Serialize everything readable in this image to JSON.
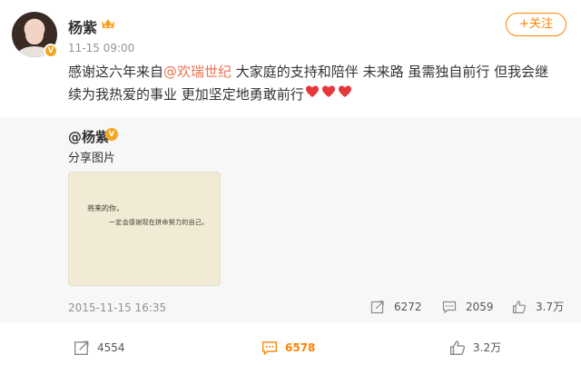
{
  "user": {
    "name": "杨紫",
    "time": "11-15 09:00",
    "verified_badge": "V"
  },
  "follow_label": "+关注",
  "post": {
    "text_before": "感谢这六年来自",
    "mention": "@欢瑞世纪",
    "text_after": " 大家庭的支持和陪伴 未来路 虽需独自前行 但我会继续为我热爱的事业 更加坚定地勇敢前行"
  },
  "repost": {
    "user": "@杨紫",
    "text": "分享图片",
    "image": {
      "line1": "将来的你，",
      "line2": "一定会感谢现在拼命努力的自己。"
    },
    "date": "2015-11-15 16:35",
    "stats": {
      "forward": "6272",
      "comment": "2059",
      "like": "3.7万"
    }
  },
  "actions": {
    "forward": "4554",
    "comment": "6578",
    "like": "3.2万"
  },
  "colors": {
    "accent": "#ff8200",
    "mention": "#eb7350",
    "heart": "#e5373c",
    "badge": "#f5a623"
  }
}
